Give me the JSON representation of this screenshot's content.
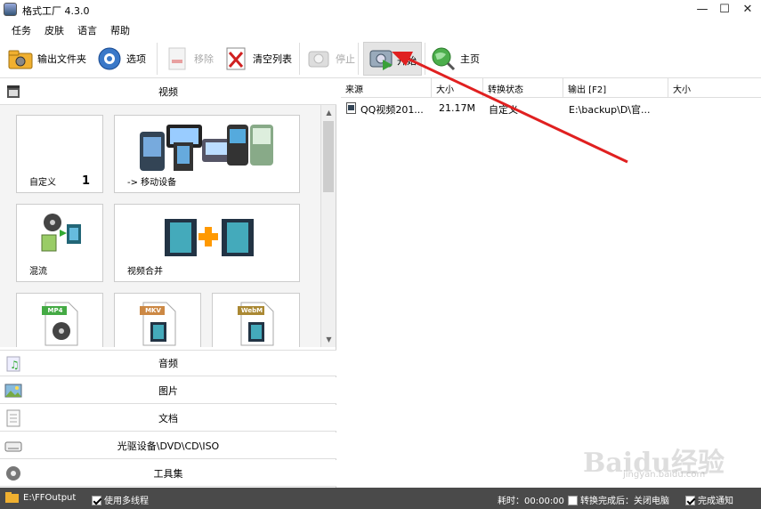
{
  "window": {
    "title": "格式工厂 4.3.0",
    "minimize": "—",
    "maximize": "☐",
    "close": "✕"
  },
  "menu": [
    "任务",
    "皮肤",
    "语言",
    "帮助"
  ],
  "toolbar": {
    "output_folder": "输出文件夹",
    "options": "选项",
    "remove": "移除",
    "clear_list": "清空列表",
    "stop": "停止",
    "start": "开始",
    "home": "主页"
  },
  "categories": {
    "video": "视频",
    "audio": "音频",
    "image": "图片",
    "document": "文档",
    "rom": "光驱设备\\DVD\\CD\\ISO",
    "tools": "工具集"
  },
  "tiles": {
    "custom": {
      "label": "自定义",
      "count": "1"
    },
    "mobile": {
      "label": "-> 移动设备"
    },
    "mux": {
      "label": "混流"
    },
    "merge": {
      "label": "视频合并"
    },
    "mp4": {
      "badge": "MP4"
    },
    "mkv": {
      "badge": "MKV"
    },
    "webm": {
      "badge": "WebM"
    }
  },
  "file_table": {
    "columns": [
      "来源",
      "大小",
      "转换状态",
      "输出 [F2]",
      "大小"
    ],
    "rows": [
      {
        "source": "QQ视频201...",
        "size": "21.17M",
        "status": "自定义",
        "output": "E:\\backup\\D\\官...",
        "out_size": ""
      }
    ]
  },
  "status": {
    "output_path": "E:\\FFOutput",
    "multithread": "使用多线程",
    "elapsed": "耗时：00:00:00",
    "after_done": "转换完成后：关闭电脑",
    "notify": "完成通知",
    "multithread_checked": true,
    "after_done_checked": false,
    "notify_checked": true
  },
  "watermark": {
    "main": "Baidu经验",
    "sub": "jingyan.baidu.com"
  },
  "colors": {
    "accent_arrow": "#e02020",
    "statusbar": "#4a4a4a"
  }
}
